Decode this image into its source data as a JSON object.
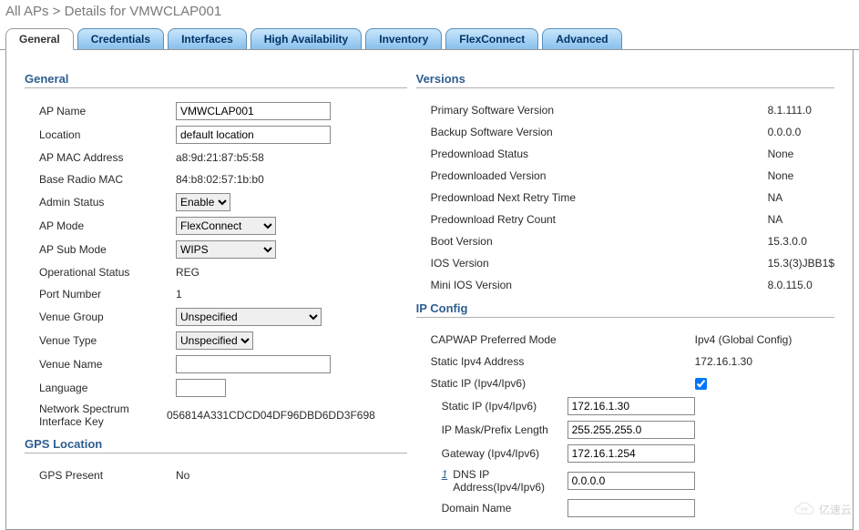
{
  "breadcrumb": "All APs > Details for VMWCLAP001",
  "tabs": [
    "General",
    "Credentials",
    "Interfaces",
    "High Availability",
    "Inventory",
    "FlexConnect",
    "Advanced"
  ],
  "activeTab": 0,
  "left": {
    "sections": {
      "general": {
        "title": "General",
        "ap_name_lbl": "AP Name",
        "ap_name_val": "VMWCLAP001",
        "location_lbl": "Location",
        "location_val": "default location",
        "ap_mac_lbl": "AP MAC Address",
        "ap_mac_val": "a8:9d:21:87:b5:58",
        "base_radio_lbl": "Base Radio MAC",
        "base_radio_val": "84:b8:02:57:1b:b0",
        "admin_status_lbl": "Admin Status",
        "admin_status_val": "Enable",
        "ap_mode_lbl": "AP Mode",
        "ap_mode_val": "FlexConnect",
        "ap_sub_mode_lbl": "AP Sub Mode",
        "ap_sub_mode_val": "WIPS",
        "op_status_lbl": "Operational Status",
        "op_status_val": "REG",
        "port_num_lbl": "Port Number",
        "port_num_val": "1",
        "venue_group_lbl": "Venue Group",
        "venue_group_val": "Unspecified",
        "venue_type_lbl": "Venue Type",
        "venue_type_val": "Unspecified",
        "venue_name_lbl": "Venue Name",
        "venue_name_val": "",
        "language_lbl": "Language",
        "language_val": "",
        "nsik_lbl": "Network Spectrum Interface Key",
        "nsik_val": "056814A331CDCD04DF96DBD6DD3F698"
      },
      "gps": {
        "title": "GPS Location",
        "gps_present_lbl": "GPS Present",
        "gps_present_val": "No"
      }
    }
  },
  "right": {
    "sections": {
      "versions": {
        "title": "Versions",
        "primary_sw_lbl": "Primary Software Version",
        "primary_sw_val": "8.1.111.0",
        "backup_sw_lbl": "Backup Software Version",
        "backup_sw_val": "0.0.0.0",
        "predl_status_lbl": "Predownload Status",
        "predl_status_val": "None",
        "predl_ver_lbl": "Predownloaded Version",
        "predl_ver_val": "None",
        "predl_retry_time_lbl": "Predownload Next Retry Time",
        "predl_retry_time_val": "NA",
        "predl_retry_count_lbl": "Predownload Retry Count",
        "predl_retry_count_val": "NA",
        "boot_ver_lbl": "Boot Version",
        "boot_ver_val": "15.3.0.0",
        "ios_ver_lbl": "IOS Version",
        "ios_ver_val": "15.3(3)JBB1$",
        "mini_ios_lbl": "Mini IOS Version",
        "mini_ios_val": "8.0.115.0"
      },
      "ip": {
        "title": "IP Config",
        "capwap_lbl": "CAPWAP Preferred Mode",
        "capwap_val": "Ipv4 (Global Config)",
        "static_ipv4_lbl": "Static Ipv4 Address",
        "static_ipv4_val": "172.16.1.30",
        "static_ip_chk_lbl": "Static IP (Ipv4/Ipv6)",
        "static_ip_chk_val": true,
        "static_ip_lbl": "Static IP (Ipv4/Ipv6)",
        "static_ip_val": "172.16.1.30",
        "ip_mask_lbl": "IP Mask/Prefix Length",
        "ip_mask_val": "255.255.255.0",
        "gateway_lbl": "Gateway (Ipv4/Ipv6)",
        "gateway_val": "172.16.1.254",
        "dns_note": "1",
        "dns_lbl": "DNS IP Address(Ipv4/Ipv6)",
        "dns_val": "0.0.0.0",
        "domain_lbl": "Domain Name",
        "domain_val": ""
      }
    }
  },
  "watermark": "亿速云"
}
